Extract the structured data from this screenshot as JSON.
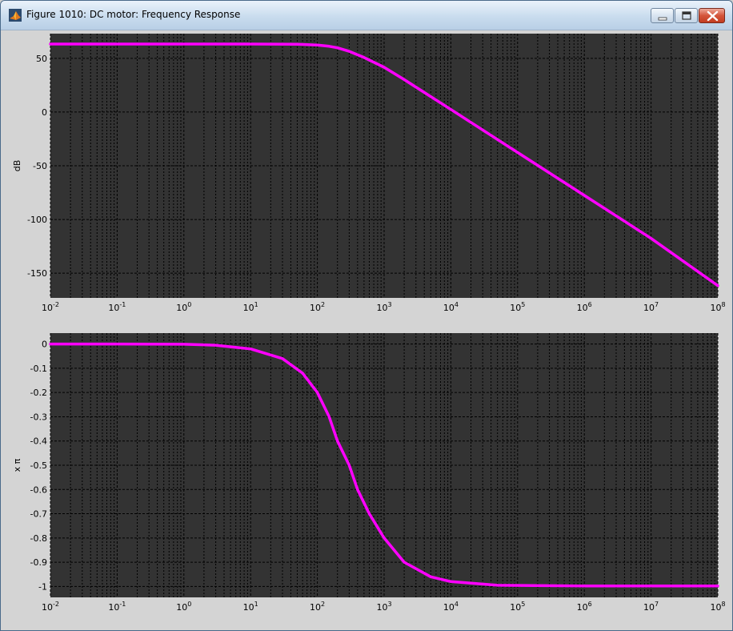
{
  "window": {
    "title": "Figure 1010: DC motor: Frequency Response",
    "app_icon": "matlab-icon",
    "controls": [
      "minimize-icon",
      "maximize-icon",
      "close-icon"
    ]
  },
  "colors": {
    "plot_bg": "#333333",
    "grid": "#000000",
    "line": "#ff00ff",
    "figure_bg": "#d4d4d4"
  },
  "chart_data": [
    {
      "type": "line",
      "xscale": "log",
      "xlim": [
        0.01,
        100000000
      ],
      "ylim": [
        -173,
        73
      ],
      "ylabel": "dB",
      "grid": true,
      "x_ticks": [
        {
          "base": "10",
          "exp": "-2"
        },
        {
          "base": "10",
          "exp": "-1"
        },
        {
          "base": "10",
          "exp": "0"
        },
        {
          "base": "10",
          "exp": "1"
        },
        {
          "base": "10",
          "exp": "2"
        },
        {
          "base": "10",
          "exp": "3"
        },
        {
          "base": "10",
          "exp": "4"
        },
        {
          "base": "10",
          "exp": "5"
        },
        {
          "base": "10",
          "exp": "6"
        },
        {
          "base": "10",
          "exp": "7"
        },
        {
          "base": "10",
          "exp": "8"
        }
      ],
      "y_ticks": [
        "50",
        "0",
        "-50",
        "-100",
        "-150"
      ],
      "y_tick_values": [
        50,
        0,
        -50,
        -100,
        -150
      ],
      "series": [
        {
          "x": [
            0.01,
            0.1,
            1,
            10,
            50,
            100,
            150,
            200,
            300,
            500,
            1000,
            2000,
            10000,
            100000,
            1000000,
            10000000,
            100000000
          ],
          "y": [
            63.3,
            63.3,
            63.3,
            63.3,
            63.1,
            62.4,
            61.2,
            59.8,
            56.5,
            50.8,
            41.7,
            30.2,
            2.4,
            -37.6,
            -77.6,
            -117.6,
            -161.6
          ]
        }
      ]
    },
    {
      "type": "line",
      "xscale": "log",
      "xlim": [
        0.01,
        100000000
      ],
      "ylim": [
        -1.045,
        0.045
      ],
      "ylabel": "x π",
      "grid": true,
      "x_ticks": [
        {
          "base": "10",
          "exp": "-2"
        },
        {
          "base": "10",
          "exp": "-1"
        },
        {
          "base": "10",
          "exp": "0"
        },
        {
          "base": "10",
          "exp": "1"
        },
        {
          "base": "10",
          "exp": "2"
        },
        {
          "base": "10",
          "exp": "3"
        },
        {
          "base": "10",
          "exp": "4"
        },
        {
          "base": "10",
          "exp": "5"
        },
        {
          "base": "10",
          "exp": "6"
        },
        {
          "base": "10",
          "exp": "7"
        },
        {
          "base": "10",
          "exp": "8"
        }
      ],
      "y_ticks": [
        "0",
        "-0.1",
        "-0.2",
        "-0.3",
        "-0.4",
        "-0.5",
        "-0.6",
        "-0.7",
        "-0.8",
        "-0.9",
        "-1"
      ],
      "y_tick_values": [
        0,
        -0.1,
        -0.2,
        -0.3,
        -0.4,
        -0.5,
        -0.6,
        -0.7,
        -0.8,
        -0.9,
        -1
      ],
      "series": [
        {
          "x": [
            0.01,
            0.1,
            1,
            3,
            10,
            30,
            60,
            100,
            150,
            200,
            300,
            400,
            600,
            1000,
            2000,
            5000,
            10000,
            50000,
            1000000,
            100000000
          ],
          "y": [
            0,
            0,
            -0.001,
            -0.005,
            -0.02,
            -0.06,
            -0.12,
            -0.2,
            -0.3,
            -0.4,
            -0.5,
            -0.6,
            -0.7,
            -0.8,
            -0.9,
            -0.96,
            -0.98,
            -0.995,
            -0.998,
            -0.998
          ]
        }
      ]
    }
  ]
}
